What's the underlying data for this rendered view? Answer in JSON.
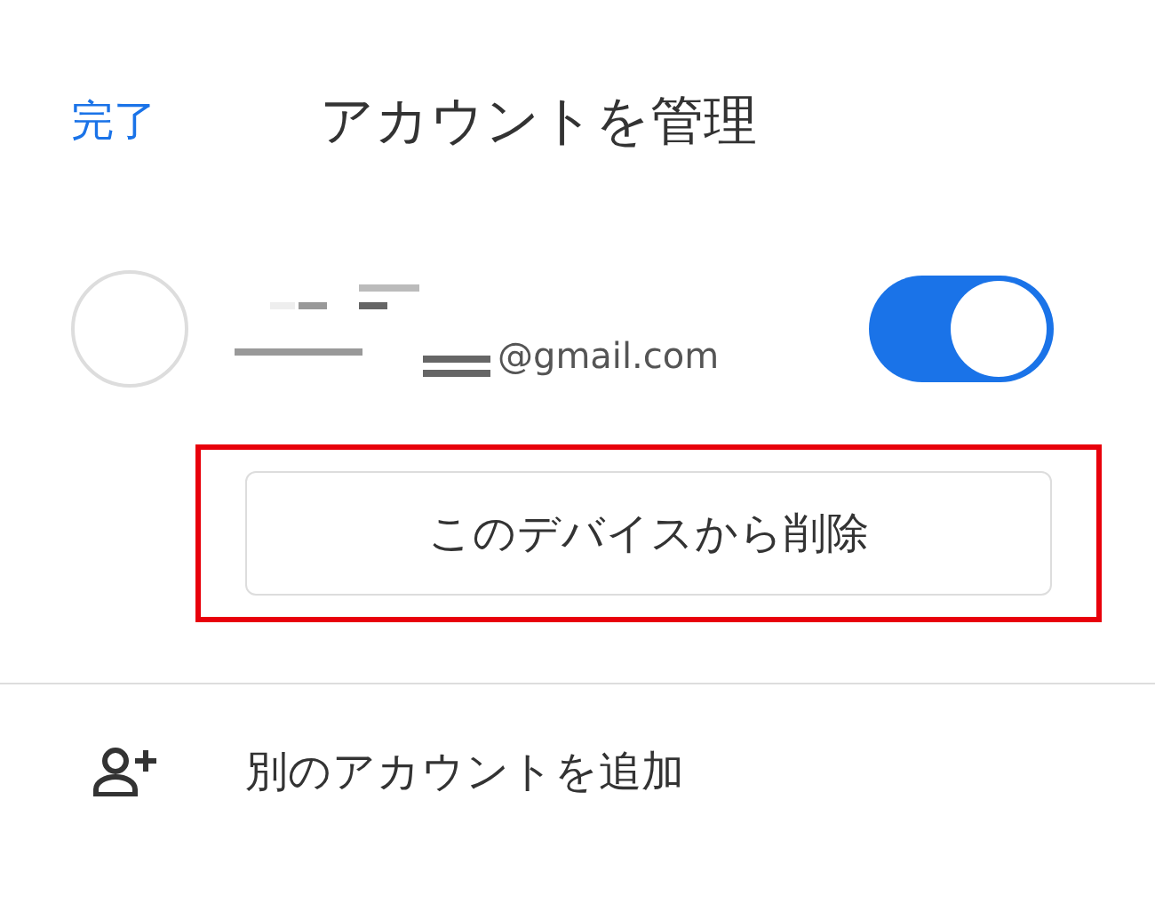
{
  "header": {
    "done": "完了",
    "title": "アカウントを管理"
  },
  "account": {
    "email": "@gmail.com",
    "on": true
  },
  "remove_button": "このデバイスから削除",
  "add_account": "別のアカウントを追加"
}
